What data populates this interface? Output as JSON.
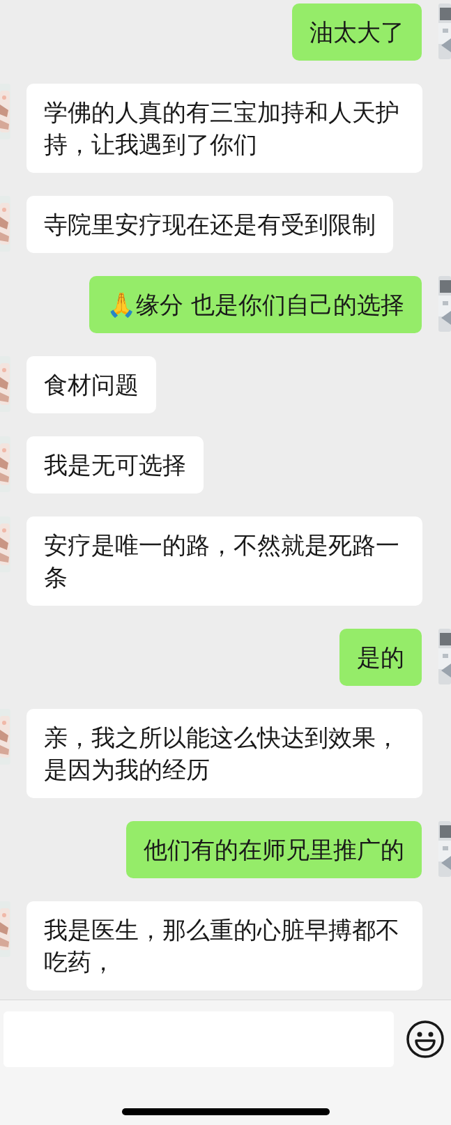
{
  "messages": [
    {
      "kind": "sent",
      "text": "油太大了"
    },
    {
      "kind": "received",
      "text": "学佛的人真的有三宝加持和人天护持，让我遇到了你们"
    },
    {
      "kind": "received",
      "text": "寺院里安疗现在还是有受到限制"
    },
    {
      "kind": "sent",
      "text": "🙏缘分 也是你们自己的选择"
    },
    {
      "kind": "received",
      "text": "食材问题"
    },
    {
      "kind": "received",
      "text": "我是无可选择"
    },
    {
      "kind": "received",
      "text": "安疗是唯一的路，不然就是死路一条"
    },
    {
      "kind": "sent",
      "text": "是的"
    },
    {
      "kind": "received",
      "text": "亲，我之所以能这么快达到效果，是因为我的经历"
    },
    {
      "kind": "sent",
      "text": "他们有的在师兄里推广的"
    },
    {
      "kind": "received",
      "text": "我是医生，那么重的心脏早搏都不吃药，"
    }
  ]
}
